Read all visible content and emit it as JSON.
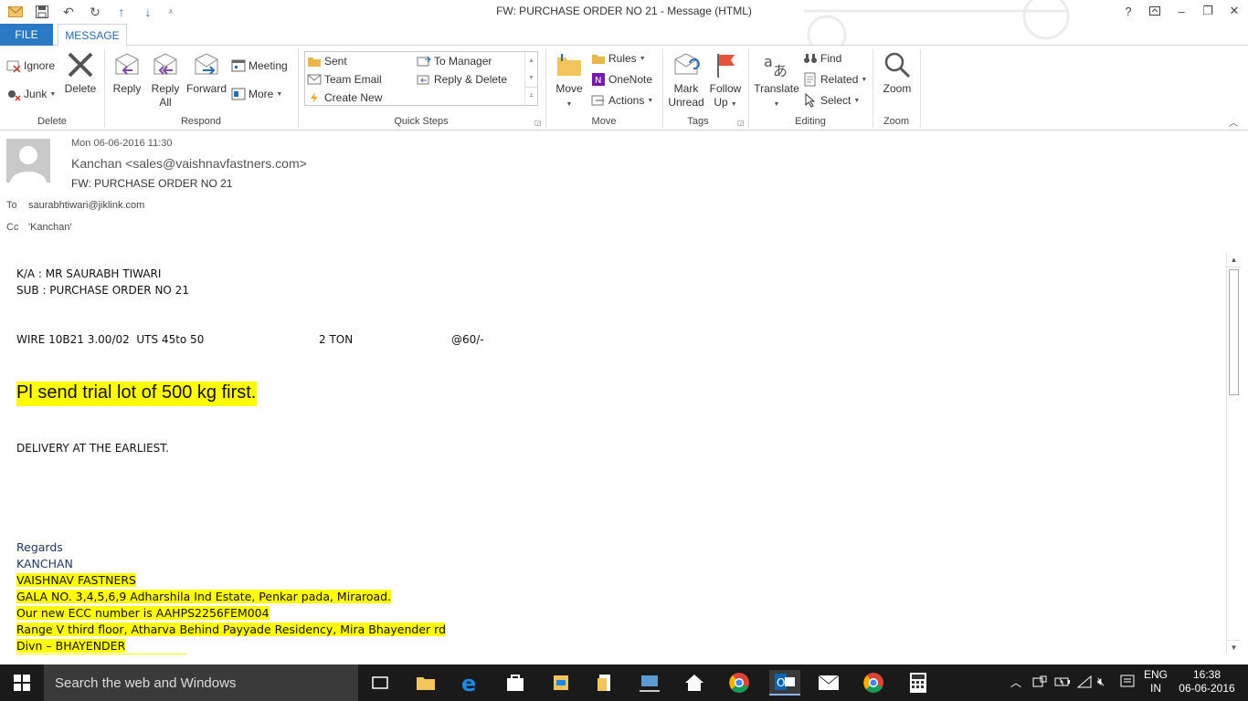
{
  "window": {
    "title": "FW: PURCHASE ORDER NO 21 - Message (HTML)",
    "help": "?",
    "controls": [
      "?",
      "▭",
      "–",
      "❐",
      "✕"
    ]
  },
  "tabs": {
    "file": "FILE",
    "message": "MESSAGE"
  },
  "ribbon": {
    "delete_group": {
      "label": "Delete",
      "ignore": "Ignore",
      "junk": "Junk",
      "delete": "Delete"
    },
    "respond_group": {
      "label": "Respond",
      "reply": "Reply",
      "reply_all_1": "Reply",
      "reply_all_2": "All",
      "forward": "Forward",
      "meeting": "Meeting",
      "more": "More"
    },
    "quicksteps_group": {
      "label": "Quick Steps",
      "items": [
        "Sent",
        "Team Email",
        "Create New",
        "To Manager",
        "Reply & Delete"
      ]
    },
    "move_group": {
      "label": "Move",
      "move": "Move",
      "rules": "Rules",
      "onenote": "OneNote",
      "actions": "Actions"
    },
    "tags_group": {
      "label": "Tags",
      "mark_unread_1": "Mark",
      "mark_unread_2": "Unread",
      "follow_up_1": "Follow",
      "follow_up_2": "Up"
    },
    "editing_group": {
      "label": "Editing",
      "translate": "Translate",
      "find": "Find",
      "related": "Related",
      "select": "Select"
    },
    "zoom_group": {
      "label": "Zoom",
      "zoom": "Zoom"
    }
  },
  "message": {
    "date": "Mon 06-06-2016 11:30",
    "from": "Kanchan <sales@vaishnavfastners.com>",
    "subject": "FW: PURCHASE ORDER NO 21",
    "to_label": "To",
    "to": "saurabhtiwari@jiklink.com",
    "cc_label": "Cc",
    "cc": "'Kanchan'"
  },
  "body": {
    "line1": "K/A : MR SAURABH TIWARI",
    "line2": "SUB : PURCHASE ORDER NO 21",
    "item_desc": "WIRE 10B21 3.00/02  UTS 45to 50",
    "item_qty": "2 TON",
    "item_rate": "@60/-",
    "highlight": "Pl send trial lot of 500 kg first.",
    "delivery": "DELIVERY AT THE EARLIEST.",
    "regards": "Regards",
    "sig_name": "KANCHAN",
    "sig_company": "VAISHNAV FASTNERS",
    "sig_addr": "GALA NO. 3,4,5,6,9 Adharshila Ind Estate, Penkar pada, Miraroad.",
    "sig_ecc": "Our new ECC number is AAHPS2256FEM004",
    "sig_range": "Range V third floor, Atharva Behind Payyade Residency, Mira Bhayender rd",
    "sig_divn": "Divn – BHAYENDER"
  },
  "taskbar": {
    "search_placeholder": "Search the web and Windows",
    "lang1": "ENG",
    "lang2": "IN",
    "time": "16:38",
    "date": "06-06-2016"
  }
}
